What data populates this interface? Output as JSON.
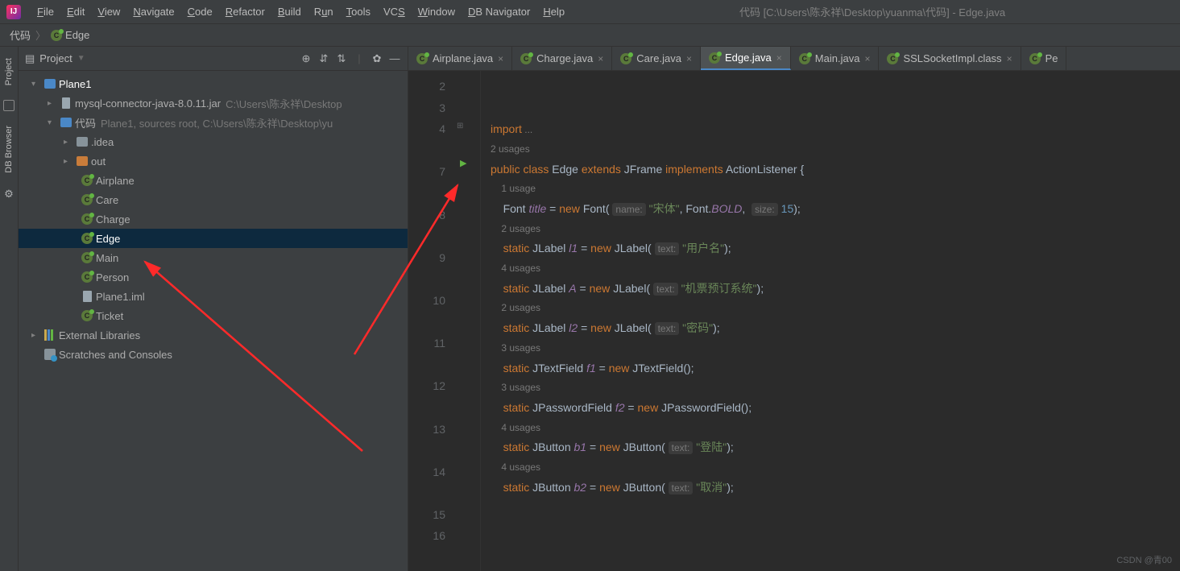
{
  "menu": {
    "items": [
      "File",
      "Edit",
      "View",
      "Navigate",
      "Code",
      "Refactor",
      "Build",
      "Run",
      "Tools",
      "VCS",
      "Window",
      "DB Navigator",
      "Help"
    ],
    "title": "代码 [C:\\Users\\陈永祥\\Desktop\\yuanma\\代码] - Edge.java"
  },
  "breadcrumb": {
    "root": "代码",
    "file": "Edge"
  },
  "panel": {
    "title": "Project",
    "tree": {
      "root": "Plane1",
      "jar": "mysql-connector-java-8.0.11.jar",
      "jar_hint": "C:\\Users\\陈永祥\\Desktop",
      "src": "代码",
      "src_hint": "Plane1, sources root, C:\\Users\\陈永祥\\Desktop\\yu",
      "idea": ".idea",
      "out": "out",
      "classes": [
        "Airplane",
        "Care",
        "Charge",
        "Edge",
        "Main",
        "Person"
      ],
      "iml": "Plane1.iml",
      "ticket": "Ticket",
      "libs": "External Libraries",
      "scratches": "Scratches and Consoles"
    }
  },
  "tabs": [
    {
      "label": "Airplane.java"
    },
    {
      "label": "Charge.java"
    },
    {
      "label": "Care.java"
    },
    {
      "label": "Edge.java",
      "active": true
    },
    {
      "label": "Main.java"
    },
    {
      "label": "SSLSocketImpl.class"
    },
    {
      "label": "Pe"
    }
  ],
  "code": {
    "line_numbers": [
      "2",
      "3",
      "4",
      "",
      "7",
      "",
      "8",
      "",
      "9",
      "",
      "10",
      "",
      "11",
      "",
      "12",
      "",
      "13",
      "",
      "14",
      "",
      "15",
      "16"
    ],
    "import_kw": "import",
    "import_rest": " ...",
    "usages2a": "2 usages",
    "decl_public": "public ",
    "decl_class": "class ",
    "decl_name": "Edge ",
    "decl_extends": "extends ",
    "decl_jframe": "JFrame ",
    "decl_impl": "implements ",
    "decl_al": "ActionListener ",
    "decl_brace": "{",
    "u1": "1 usage",
    "l8_a": "Font ",
    "l8_b": "title",
    "l8_c": " = ",
    "l8_d": "new ",
    "l8_e": "Font( ",
    "l8_p1": "name:",
    "l8_s1": " \"宋体\"",
    "l8_f": ", Font.",
    "l8_g": "BOLD",
    "l8_h": ",  ",
    "l8_p2": "size:",
    "l8_n": " 15",
    "l8_i": ");",
    "u2": "2 usages",
    "l9_a": "static ",
    "l9_b": "JLabel ",
    "l9_c": "l1",
    "l9_d": " = ",
    "l9_e": "new ",
    "l9_f": "JLabel( ",
    "l9_p": "text:",
    "l9_s": " \"用户名\"",
    "l9_g": ");",
    "u4": "4 usages",
    "l10_a": "static ",
    "l10_b": "JLabel ",
    "l10_c": "A",
    "l10_d": " = ",
    "l10_e": "new ",
    "l10_f": "JLabel( ",
    "l10_p": "text:",
    "l10_s": " \"机票预订系统\"",
    "l10_g": ");",
    "u2b": "2 usages",
    "l11_a": "static ",
    "l11_b": "JLabel ",
    "l11_c": "l2",
    "l11_d": " = ",
    "l11_e": "new ",
    "l11_f": "JLabel( ",
    "l11_p": "text:",
    "l11_s": " \"密码\"",
    "l11_g": ");",
    "u3": "3 usages",
    "l12_a": "static ",
    "l12_b": "JTextField ",
    "l12_c": "f1",
    "l12_d": " = ",
    "l12_e": "new ",
    "l12_f": "JTextField();",
    "u3b": "3 usages",
    "l13_a": "static ",
    "l13_b": "JPasswordField ",
    "l13_c": "f2",
    "l13_d": " = ",
    "l13_e": "new ",
    "l13_f": "JPasswordField();",
    "u4b": "4 usages",
    "l14_a": "static ",
    "l14_b": "JButton ",
    "l14_c": "b1",
    "l14_d": " = ",
    "l14_e": "new ",
    "l14_f": "JButton( ",
    "l14_p": "text:",
    "l14_s": " \"登陆\"",
    "l14_g": ");",
    "u4c": "4 usages",
    "l15_a": "static ",
    "l15_b": "JButton ",
    "l15_c": "b2",
    "l15_d": " = ",
    "l15_e": "new ",
    "l15_f": "JButton( ",
    "l15_p": "text:",
    "l15_s": " \"取消\"",
    "l15_g": ");"
  },
  "watermark": "CSDN @青00"
}
